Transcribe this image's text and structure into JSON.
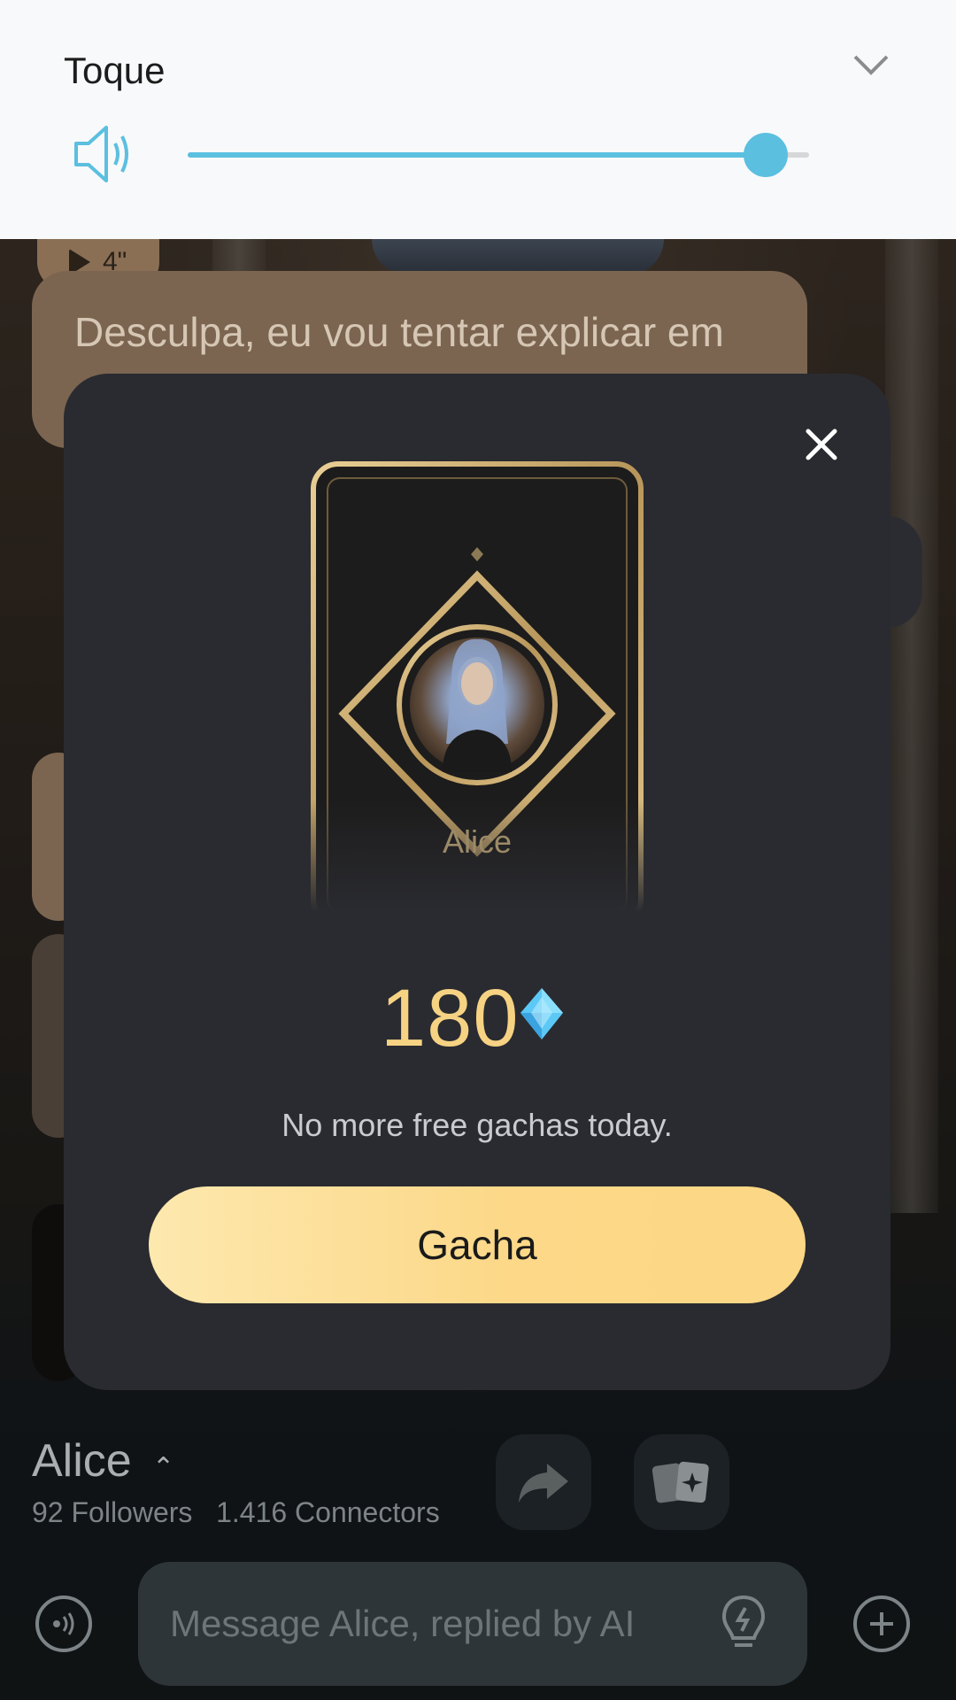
{
  "volume_panel": {
    "title": "Toque",
    "level_fraction": 0.93
  },
  "chat": {
    "audio_duration": "4\"",
    "message_1": "Desculpa, eu vou tentar explicar em"
  },
  "modal": {
    "character_name": "Alice",
    "price": "180",
    "notice": "No more free gachas today.",
    "button_label": "Gacha"
  },
  "profile": {
    "name": "Alice",
    "followers": "92 Followers",
    "connectors": "1.416 Connectors"
  },
  "composer": {
    "placeholder": "Message Alice, replied by AI"
  },
  "icons": [
    "speaker-icon",
    "chevron-down-icon",
    "close-icon",
    "diamond-gem-icon",
    "share-icon",
    "cards-icon",
    "voice-icon",
    "lightbulb-icon",
    "plus-icon",
    "play-icon",
    "chevron-up-icon"
  ],
  "colors": {
    "accent": "#5bbfe0",
    "gold": "#f6d283",
    "button": "#fcd888",
    "modal_bg": "#2a2b30"
  }
}
